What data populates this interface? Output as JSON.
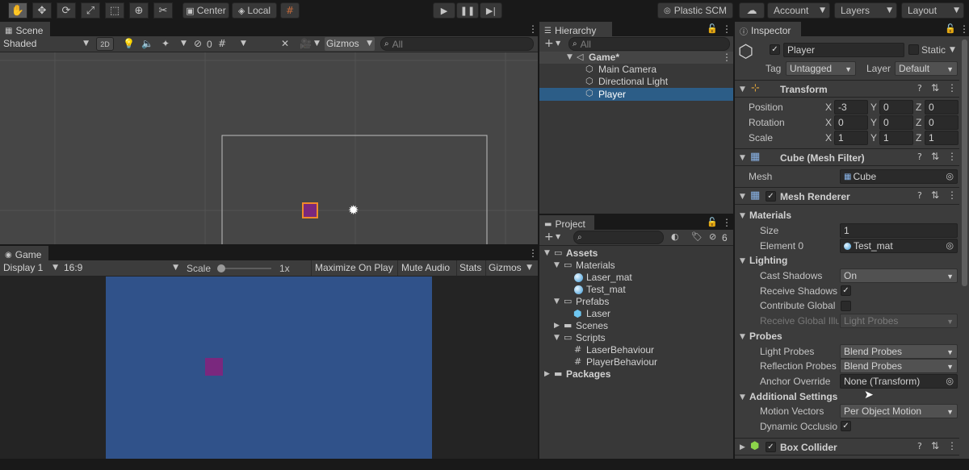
{
  "toolbar": {
    "pivot_mode": "Center",
    "pivot_space": "Local",
    "plastic_scm": "Plastic SCM",
    "account": "Account",
    "layers": "Layers",
    "layout": "Layout"
  },
  "scene": {
    "tab_label": "Scene",
    "shading_mode": "Shaded",
    "mode_2d": "2D",
    "hidden_count": "0",
    "gizmos": "Gizmos",
    "search_placeholder": "All"
  },
  "game": {
    "tab_label": "Game",
    "display": "Display 1",
    "aspect": "16:9",
    "scale_label": "Scale",
    "scale_value": "1x",
    "maximize": "Maximize On Play",
    "mute": "Mute Audio",
    "stats": "Stats",
    "gizmos": "Gizmos",
    "background_color": "#30528a",
    "player_color": "#7a287e"
  },
  "hierarchy": {
    "tab_label": "Hierarchy",
    "search_placeholder": "All",
    "scene_name": "Game*",
    "items": [
      "Main Camera",
      "Directional Light",
      "Player"
    ]
  },
  "project": {
    "tab_label": "Project",
    "badge_count": "6",
    "root": "Assets",
    "materials": "Materials",
    "laser_mat": "Laser_mat",
    "test_mat": "Test_mat",
    "prefabs": "Prefabs",
    "laser": "Laser",
    "scenes": "Scenes",
    "scripts": "Scripts",
    "laser_behaviour": "LaserBehaviour",
    "player_behaviour": "PlayerBehaviour",
    "packages": "Packages"
  },
  "inspector": {
    "tab_label": "Inspector",
    "object_name": "Player",
    "static_label": "Static",
    "tag_label": "Tag",
    "tag_value": "Untagged",
    "layer_label": "Layer",
    "layer_value": "Default",
    "transform": {
      "title": "Transform",
      "position_label": "Position",
      "rotation_label": "Rotation",
      "scale_label": "Scale",
      "x": "X",
      "y": "Y",
      "z": "Z",
      "position": [
        "-3",
        "0",
        "0"
      ],
      "rotation": [
        "0",
        "0",
        "0"
      ],
      "scale": [
        "1",
        "1",
        "1"
      ]
    },
    "mesh_filter": {
      "title": "Cube (Mesh Filter)",
      "mesh_label": "Mesh",
      "mesh_value": "Cube"
    },
    "mesh_renderer": {
      "title": "Mesh Renderer",
      "materials": "Materials",
      "size_label": "Size",
      "size_value": "1",
      "element0_label": "Element 0",
      "element0_value": "Test_mat",
      "lighting": "Lighting",
      "cast_shadows_label": "Cast Shadows",
      "cast_shadows_value": "On",
      "receive_shadows_label": "Receive Shadows",
      "contribute_gi_label": "Contribute Global",
      "receive_gi_label": "Receive Global Illu",
      "receive_gi_value": "Light Probes",
      "probes": "Probes",
      "light_probes_label": "Light Probes",
      "light_probes_value": "Blend Probes",
      "reflection_probes_label": "Reflection Probes",
      "reflection_probes_value": "Blend Probes",
      "anchor_override_label": "Anchor Override",
      "anchor_override_value": "None (Transform)",
      "additional_settings": "Additional Settings",
      "motion_vectors_label": "Motion Vectors",
      "motion_vectors_value": "Per Object Motion",
      "dynamic_occlusion_label": "Dynamic Occlusio"
    },
    "box_collider": {
      "title": "Box Collider"
    }
  }
}
